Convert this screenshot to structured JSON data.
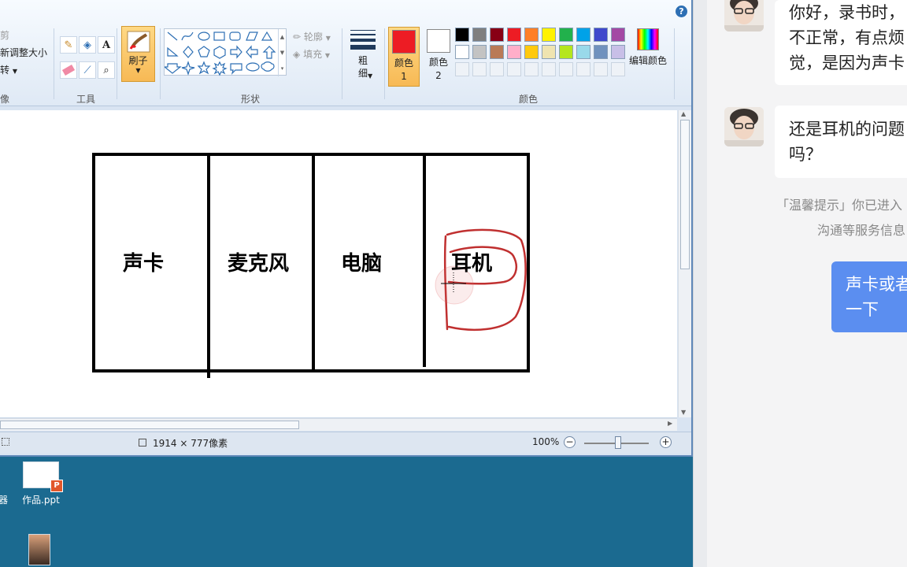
{
  "ribbon": {
    "clipboard_cut": "剪",
    "resize": "新调整大小",
    "rotate": "转",
    "image_group_tail": "像",
    "tools_label": "工具",
    "brush_label": "刷子",
    "shapes_label": "形状",
    "outline_label": "轮廓",
    "fill_label": "填充",
    "size_label": "粗细",
    "color1_label": "颜色 1",
    "color2_label": "颜色 2",
    "colors_label": "颜色",
    "edit_colors_label": "编辑颜色",
    "help": "?"
  },
  "canvas": {
    "cells": [
      "声卡",
      "麦克风",
      "电脑",
      "耳机"
    ]
  },
  "statusbar": {
    "dimensions": "1914 × 777像素",
    "zoom": "100%",
    "zoom_minus": "−",
    "zoom_plus": "+"
  },
  "desktop": {
    "icon_ppt_label": "作品.ppt",
    "icon_left_label": "器"
  },
  "colors": {
    "color1": "#ed1c24",
    "color2": "#ffffff",
    "palette_row1": [
      "#000000",
      "#7f7f7f",
      "#880015",
      "#ed1c24",
      "#ff7f27",
      "#fff200",
      "#22b14c",
      "#00a2e8",
      "#3f48cc",
      "#a349a4"
    ],
    "palette_row2": [
      "#ffffff",
      "#c3c3c3",
      "#b97a57",
      "#ffaec9",
      "#ffc90e",
      "#efe4b0",
      "#b5e61d",
      "#99d9ea",
      "#7092be",
      "#c8bfe7"
    ]
  },
  "chat": {
    "msg1_lines": [
      "你好，录书时，",
      "不正常，有点烦",
      "觉，是因为声卡"
    ],
    "msg2_lines": [
      "还是耳机的问题",
      "吗？"
    ],
    "notice_lines": [
      "「温馨提示」你已进入",
      "沟通等服务信息"
    ],
    "reply_lines": [
      "声卡或者",
      "一下"
    ]
  }
}
